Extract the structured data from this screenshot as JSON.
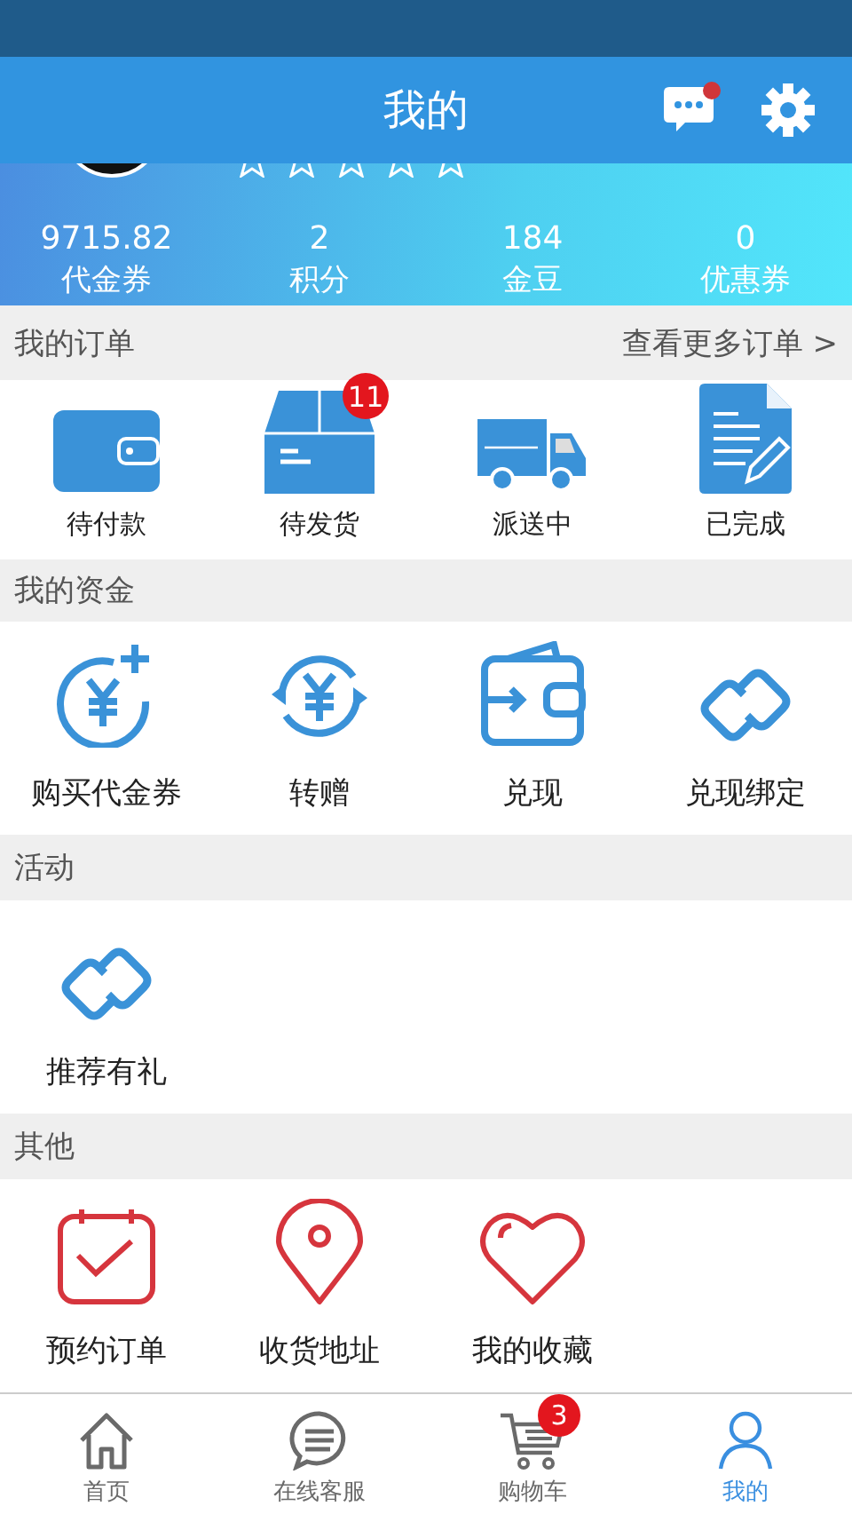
{
  "header": {
    "title": "我的",
    "message_unread": true
  },
  "profile": {
    "stats": [
      {
        "value": "9715.82",
        "label": "代金券"
      },
      {
        "value": "2",
        "label": "积分"
      },
      {
        "value": "184",
        "label": "金豆"
      },
      {
        "value": "0",
        "label": "优惠券"
      }
    ]
  },
  "sections": [
    {
      "title": "我的订单",
      "link": "查看更多订单 >",
      "items": [
        {
          "label": "待付款"
        },
        {
          "label": "待发货",
          "badge": "11"
        },
        {
          "label": "派送中"
        },
        {
          "label": "已完成"
        }
      ]
    },
    {
      "title": "我的资金",
      "items": [
        {
          "label": "购买代金券"
        },
        {
          "label": "转赠"
        },
        {
          "label": "兑现"
        },
        {
          "label": "兑现绑定"
        }
      ]
    },
    {
      "title": "活动",
      "items": [
        {
          "label": "推荐有礼"
        }
      ]
    },
    {
      "title": "其他",
      "items": [
        {
          "label": "预约订单"
        },
        {
          "label": "收货地址"
        },
        {
          "label": "我的收藏"
        }
      ]
    }
  ],
  "tab_bar": [
    {
      "label": "首页",
      "selected": false
    },
    {
      "label": "在线客服",
      "selected": false
    },
    {
      "label": "购物车",
      "selected": false,
      "badge": "3"
    },
    {
      "label": "我的",
      "selected": true
    }
  ]
}
